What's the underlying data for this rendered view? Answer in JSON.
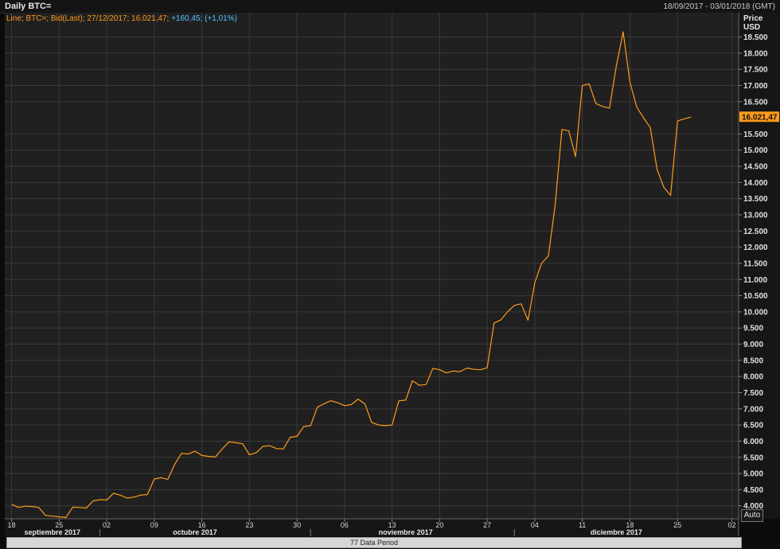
{
  "header": {
    "title": "Daily BTC=",
    "date_range": "18/09/2017 - 03/01/2018 (GMT)"
  },
  "legend": {
    "main": "Line; BTC=; Bid(Last); 27/12/2017; 16.021,47;",
    "change": "+160,45; (+1,01%)"
  },
  "y_axis": {
    "title_line1": "Price",
    "title_line2": "USD"
  },
  "auto_button": "Auto",
  "period_bar": "77 Data Period",
  "colors": {
    "line": "#ff9a1a",
    "change": "#4fc3ff",
    "grid": "#3a3a3a",
    "plot_bg": "#202020",
    "price_badge": "#ff9a1a"
  },
  "chart_data": {
    "type": "line",
    "series": [
      {
        "name": "BTC=",
        "x": [
          "2017-09-18",
          "2017-09-19",
          "2017-09-20",
          "2017-09-21",
          "2017-09-22",
          "2017-09-23",
          "2017-09-24",
          "2017-09-25",
          "2017-09-26",
          "2017-09-27",
          "2017-09-28",
          "2017-09-29",
          "2017-09-30",
          "2017-10-01",
          "2017-10-02",
          "2017-10-03",
          "2017-10-04",
          "2017-10-05",
          "2017-10-06",
          "2017-10-07",
          "2017-10-08",
          "2017-10-09",
          "2017-10-10",
          "2017-10-11",
          "2017-10-12",
          "2017-10-13",
          "2017-10-14",
          "2017-10-15",
          "2017-10-16",
          "2017-10-17",
          "2017-10-18",
          "2017-10-19",
          "2017-10-20",
          "2017-10-21",
          "2017-10-22",
          "2017-10-23",
          "2017-10-24",
          "2017-10-25",
          "2017-10-26",
          "2017-10-27",
          "2017-10-28",
          "2017-10-29",
          "2017-10-30",
          "2017-10-31",
          "2017-11-01",
          "2017-11-02",
          "2017-11-03",
          "2017-11-04",
          "2017-11-05",
          "2017-11-06",
          "2017-11-07",
          "2017-11-08",
          "2017-11-09",
          "2017-11-10",
          "2017-11-11",
          "2017-11-12",
          "2017-11-13",
          "2017-11-14",
          "2017-11-15",
          "2017-11-16",
          "2017-11-17",
          "2017-11-18",
          "2017-11-19",
          "2017-11-20",
          "2017-11-21",
          "2017-11-22",
          "2017-11-23",
          "2017-11-24",
          "2017-11-25",
          "2017-11-26",
          "2017-11-27",
          "2017-11-28",
          "2017-11-29",
          "2017-11-30",
          "2017-12-01",
          "2017-12-02",
          "2017-12-03",
          "2017-12-04",
          "2017-12-05",
          "2017-12-06",
          "2017-12-07",
          "2017-12-08",
          "2017-12-09",
          "2017-12-10",
          "2017-12-11",
          "2017-12-12",
          "2017-12-13",
          "2017-12-14",
          "2017-12-15",
          "2017-12-16",
          "2017-12-17",
          "2017-12-18",
          "2017-12-19",
          "2017-12-20",
          "2017-12-21",
          "2017-12-22",
          "2017-12-23",
          "2017-12-24",
          "2017-12-25",
          "2017-12-26",
          "2017-12-27"
        ],
        "y": [
          4050,
          3950,
          3990,
          3980,
          3950,
          3700,
          3680,
          3660,
          3640,
          3960,
          3950,
          3930,
          4150,
          4190,
          4180,
          4390,
          4330,
          4240,
          4270,
          4330,
          4350,
          4830,
          4870,
          4820,
          5280,
          5620,
          5600,
          5690,
          5560,
          5530,
          5510,
          5760,
          5980,
          5950,
          5920,
          5580,
          5640,
          5840,
          5860,
          5770,
          5760,
          6120,
          6150,
          6450,
          6480,
          7050,
          7160,
          7250,
          7190,
          7100,
          7130,
          7300,
          7150,
          6580,
          6500,
          6480,
          6500,
          7250,
          7270,
          7870,
          7730,
          7750,
          8250,
          8210,
          8110,
          8170,
          8150,
          8260,
          8220,
          8210,
          8270,
          9650,
          9750,
          10000,
          10200,
          10250,
          9740,
          10900,
          11500,
          11730,
          13300,
          15640,
          15600,
          14800,
          17000,
          17050,
          16440,
          16350,
          16300,
          17600,
          18660,
          17110,
          16340,
          16000,
          15700,
          14400,
          13850,
          13600,
          15900,
          15970,
          16021.47
        ]
      }
    ],
    "last_value": "16.021,47",
    "x_ticks": [
      {
        "date": "2017-09-18",
        "label": "18"
      },
      {
        "date": "2017-09-25",
        "label": "25"
      },
      {
        "date": "2017-10-02",
        "label": "02"
      },
      {
        "date": "2017-10-09",
        "label": "09"
      },
      {
        "date": "2017-10-16",
        "label": "16"
      },
      {
        "date": "2017-10-23",
        "label": "23"
      },
      {
        "date": "2017-10-30",
        "label": "30"
      },
      {
        "date": "2017-11-06",
        "label": "06"
      },
      {
        "date": "2017-11-13",
        "label": "13"
      },
      {
        "date": "2017-11-20",
        "label": "20"
      },
      {
        "date": "2017-11-27",
        "label": "27"
      },
      {
        "date": "2017-12-04",
        "label": "04"
      },
      {
        "date": "2017-12-11",
        "label": "11"
      },
      {
        "date": "2017-12-18",
        "label": "18"
      },
      {
        "date": "2017-12-25",
        "label": "25"
      },
      {
        "date": "2018-01-02",
        "label": "02"
      }
    ],
    "month_labels": [
      {
        "date": "2017-09-24",
        "label": "septiembre 2017"
      },
      {
        "date": "2017-10-15",
        "label": "octubre 2017"
      },
      {
        "date": "2017-11-15",
        "label": "noviembre 2017"
      },
      {
        "date": "2017-12-16",
        "label": "diciembre 2017"
      }
    ],
    "month_boundaries": [
      "2017-10-01",
      "2017-11-01",
      "2017-12-01"
    ],
    "y_ticks": [
      {
        "value": 4000,
        "label": "4.000"
      },
      {
        "value": 4500,
        "label": "4.500"
      },
      {
        "value": 5000,
        "label": "5.000"
      },
      {
        "value": 5500,
        "label": "5.500"
      },
      {
        "value": 6000,
        "label": "6.000"
      },
      {
        "value": 6500,
        "label": "6.500"
      },
      {
        "value": 7000,
        "label": "7.000"
      },
      {
        "value": 7500,
        "label": "7.500"
      },
      {
        "value": 8000,
        "label": "8.000"
      },
      {
        "value": 8500,
        "label": "8.500"
      },
      {
        "value": 9000,
        "label": "9.000"
      },
      {
        "value": 9500,
        "label": "9.500"
      },
      {
        "value": 10000,
        "label": "10.000"
      },
      {
        "value": 10500,
        "label": "10.500"
      },
      {
        "value": 11000,
        "label": "11.000"
      },
      {
        "value": 11500,
        "label": "11.500"
      },
      {
        "value": 12000,
        "label": "12.000"
      },
      {
        "value": 12500,
        "label": "12.500"
      },
      {
        "value": 13000,
        "label": "13.000"
      },
      {
        "value": 13500,
        "label": "13.500"
      },
      {
        "value": 14000,
        "label": "14.000"
      },
      {
        "value": 14500,
        "label": "14.500"
      },
      {
        "value": 15000,
        "label": "15.000"
      },
      {
        "value": 15500,
        "label": "15.500"
      },
      {
        "value": 16500,
        "label": "16.500"
      },
      {
        "value": 17000,
        "label": "17.000"
      },
      {
        "value": 17500,
        "label": "17.500"
      },
      {
        "value": 18000,
        "label": "18.000"
      },
      {
        "value": 18500,
        "label": "18.500"
      }
    ],
    "x_range": [
      "2017-09-17",
      "2018-01-03"
    ],
    "ylim": [
      3600,
      19250
    ],
    "grid": true
  }
}
